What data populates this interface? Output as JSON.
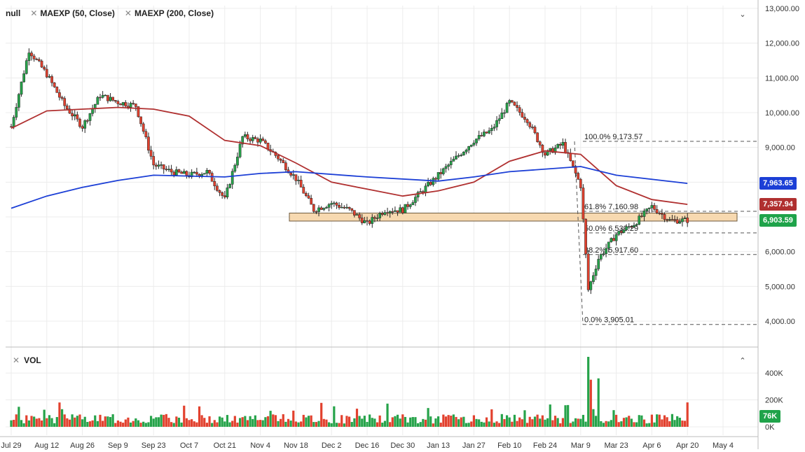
{
  "legend": {
    "symbol": "null",
    "ma50": "MAEXP (50, Close)",
    "ma200": "MAEXP (200, Close)",
    "close_icon": "close-icon"
  },
  "volume_legend": {
    "label": "VOL",
    "close_icon": "close-icon"
  },
  "controls": {
    "top_chevron": "chevron-down-icon",
    "volume_chevron": "chevron-up-icon"
  },
  "price_tags": [
    {
      "value": "7,963.65",
      "color": "#1c3fd6"
    },
    {
      "value": "7,357.94",
      "color": "#b03030"
    },
    {
      "value": "6,903.59",
      "color": "#1fa34a"
    }
  ],
  "volume_tag": {
    "value": "76K",
    "color": "#1fa34a"
  },
  "colors": {
    "up": "#26a34a",
    "down": "#e2412e",
    "ma50": "#b03030",
    "ma200": "#1c3fd6",
    "zone": "#f7d9b0"
  },
  "chart_data": [
    {
      "type": "candlestick",
      "title": "",
      "x_ticks": [
        "Jul 29",
        "Aug 12",
        "Aug 26",
        "Sep 9",
        "Sep 23",
        "Oct 7",
        "Oct 21",
        "Nov 4",
        "Nov 18",
        "Dec 2",
        "Dec 16",
        "Dec 30",
        "Jan 13",
        "Jan 27",
        "Feb 10",
        "Feb 24",
        "Mar 9",
        "Mar 23",
        "Apr 6",
        "Apr 20",
        "May 4"
      ],
      "y_ticks": [
        "13,000.00",
        "12,000.00",
        "11,000.00",
        "10,000.00",
        "9,000.00",
        "8,000.00",
        "7,000.00",
        "6,000.00",
        "5,000.00",
        "4,000.00"
      ],
      "ylim": [
        3800,
        13000
      ],
      "close_series": [
        [
          "Jul 29",
          9600
        ],
        [
          "Aug 5",
          11800
        ],
        [
          "Aug 12",
          11100
        ],
        [
          "Aug 19",
          10200
        ],
        [
          "Aug 26",
          9600
        ],
        [
          "Sep 2",
          10500
        ],
        [
          "Sep 9",
          10300
        ],
        [
          "Sep 16",
          10200
        ],
        [
          "Sep 23",
          8500
        ],
        [
          "Sep 30",
          8300
        ],
        [
          "Oct 7",
          8200
        ],
        [
          "Oct 14",
          8300
        ],
        [
          "Oct 21",
          7500
        ],
        [
          "Oct 28",
          9300
        ],
        [
          "Nov 4",
          9200
        ],
        [
          "Nov 11",
          8700
        ],
        [
          "Nov 18",
          8100
        ],
        [
          "Nov 25",
          7200
        ],
        [
          "Dec 2",
          7400
        ],
        [
          "Dec 9",
          7200
        ],
        [
          "Dec 16",
          6800
        ],
        [
          "Dec 23",
          7200
        ],
        [
          "Dec 30",
          7200
        ],
        [
          "Jan 6",
          7700
        ],
        [
          "Jan 13",
          8200
        ],
        [
          "Jan 27",
          9200
        ],
        [
          "Feb 3",
          9500
        ],
        [
          "Feb 10",
          10300
        ],
        [
          "Feb 17",
          9800
        ],
        [
          "Feb 24",
          8800
        ],
        [
          "Mar 2",
          9100
        ],
        [
          "Mar 9",
          7900
        ],
        [
          "Mar 12",
          4900
        ],
        [
          "Mar 16",
          5800
        ],
        [
          "Mar 23",
          6500
        ],
        [
          "Mar 30",
          6800
        ],
        [
          "Apr 6",
          7300
        ],
        [
          "Apr 13",
          6900
        ],
        [
          "Apr 20",
          6904
        ]
      ],
      "moving_averages": [
        {
          "name": "MAEXP (50, Close)",
          "last": 7357.94,
          "points": [
            [
              "Jul 29",
              9550
            ],
            [
              "Aug 12",
              10050
            ],
            [
              "Sep 9",
              10150
            ],
            [
              "Sep 23",
              10100
            ],
            [
              "Oct 7",
              9900
            ],
            [
              "Oct 21",
              9200
            ],
            [
              "Nov 4",
              9050
            ],
            [
              "Nov 18",
              8550
            ],
            [
              "Dec 2",
              8000
            ],
            [
              "Dec 16",
              7800
            ],
            [
              "Dec 30",
              7600
            ],
            [
              "Jan 13",
              7750
            ],
            [
              "Jan 27",
              8000
            ],
            [
              "Feb 10",
              8600
            ],
            [
              "Feb 24",
              8900
            ],
            [
              "Mar 9",
              8800
            ],
            [
              "Mar 23",
              7900
            ],
            [
              "Apr 6",
              7500
            ],
            [
              "Apr 20",
              7360
            ]
          ]
        },
        {
          "name": "MAEXP (200, Close)",
          "last": 7963.65,
          "points": [
            [
              "Jul 29",
              7250
            ],
            [
              "Aug 12",
              7600
            ],
            [
              "Aug 26",
              7850
            ],
            [
              "Sep 9",
              8050
            ],
            [
              "Sep 23",
              8200
            ],
            [
              "Oct 21",
              8150
            ],
            [
              "Nov 4",
              8250
            ],
            [
              "Nov 18",
              8300
            ],
            [
              "Dec 16",
              8150
            ],
            [
              "Jan 13",
              8030
            ],
            [
              "Jan 27",
              8150
            ],
            [
              "Feb 10",
              8300
            ],
            [
              "Mar 9",
              8450
            ],
            [
              "Mar 23",
              8200
            ],
            [
              "Apr 20",
              7964
            ]
          ]
        }
      ],
      "fibonacci": [
        {
          "label": "100.0% 9,173.57",
          "value": 9173.57
        },
        {
          "label": "61.8% 7,160.98",
          "value": 7160.98
        },
        {
          "label": "50.0% 6,539.29",
          "value": 6539.29
        },
        {
          "label": "38.2% 5,917.60",
          "value": 5917.6
        },
        {
          "label": "0.0% 3,905.01",
          "value": 3905.01
        }
      ],
      "support_zone": [
        6880,
        7110
      ],
      "last_price": 6903.59
    },
    {
      "type": "bar",
      "title": "VOL",
      "y_ticks": [
        "400K",
        "200K",
        "0K"
      ],
      "ylim": [
        0,
        520000
      ],
      "peak": [
        [
          "Mar 12",
          520000
        ],
        [
          "Mar 13",
          350000
        ],
        [
          "Mar 16",
          360000
        ]
      ],
      "last": 76000
    }
  ]
}
